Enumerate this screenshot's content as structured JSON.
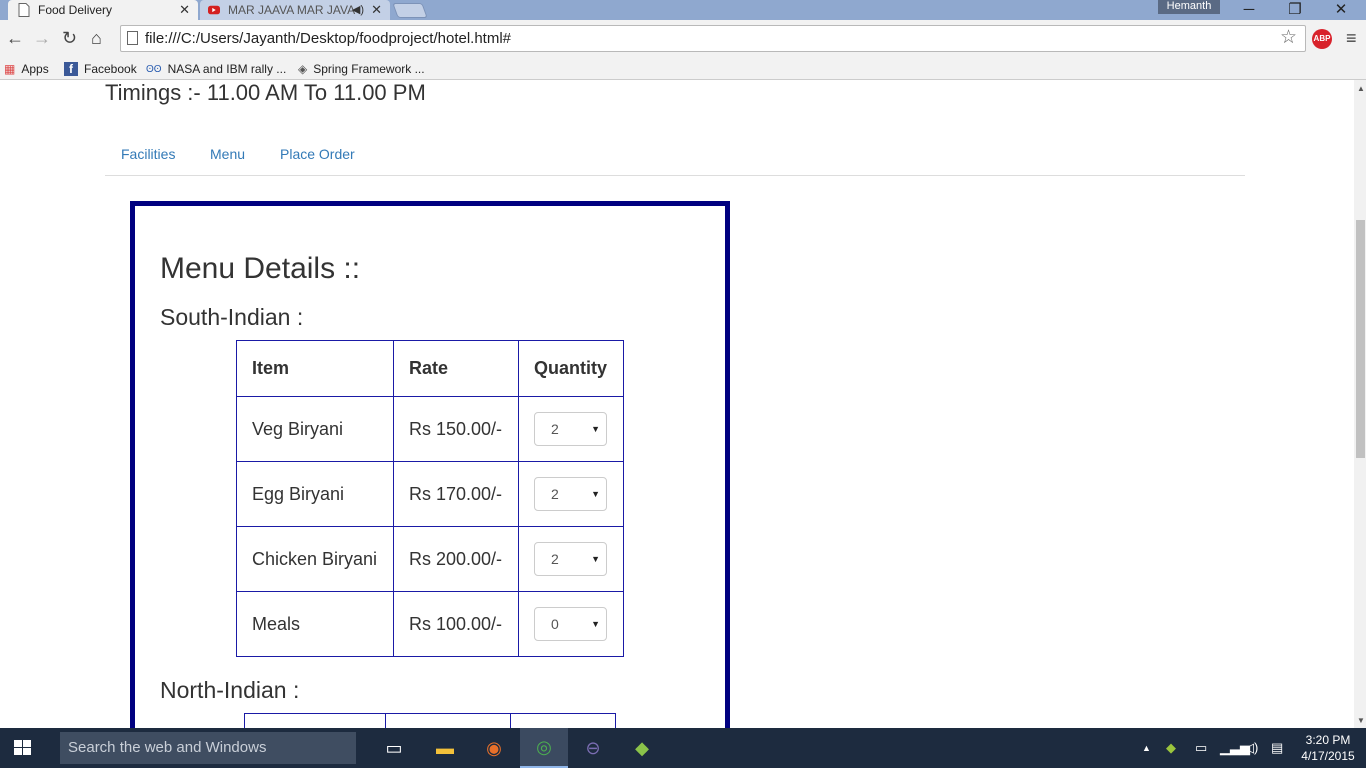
{
  "browser": {
    "tabs": [
      {
        "title": "Food Delivery",
        "active": true
      },
      {
        "title": "MAR JAAVA MAR JAVA",
        "active": false
      }
    ],
    "user": "Hemanth",
    "url": "file:///C:/Users/Jayanth/Desktop/foodproject/hotel.html#",
    "bookmarks": [
      "Apps",
      "Facebook",
      "NASA and IBM rally ...",
      "Spring Framework ..."
    ]
  },
  "page": {
    "timings": "Timings :- 11.00 AM To 11.00 PM",
    "nav": [
      "Facilities",
      "Menu",
      "Place Order"
    ],
    "menu_title": "Menu Details ::",
    "sections": [
      {
        "name": "South-Indian :",
        "headers": [
          "Item",
          "Rate",
          "Quantity"
        ],
        "rows": [
          {
            "item": "Veg Biryani",
            "rate": "Rs 150.00/-",
            "qty": "2"
          },
          {
            "item": "Egg Biryani",
            "rate": "Rs 170.00/-",
            "qty": "2"
          },
          {
            "item": "Chicken Biryani",
            "rate": "Rs 200.00/-",
            "qty": "2"
          },
          {
            "item": "Meals",
            "rate": "Rs 100.00/-",
            "qty": "0"
          }
        ]
      },
      {
        "name": "North-Indian :"
      }
    ]
  },
  "taskbar": {
    "search_placeholder": "Search the web and Windows",
    "time": "3:20 PM",
    "date": "4/17/2015"
  },
  "colors": {
    "menu_border": "#000080",
    "table_border": "#1a1aa6",
    "link": "#337ab7",
    "taskbar": "#1d2b3f"
  }
}
